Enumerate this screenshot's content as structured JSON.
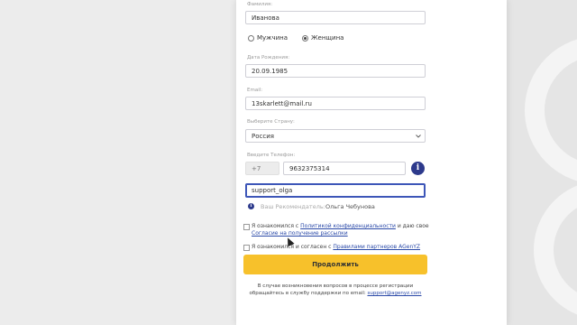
{
  "form": {
    "surname_label": "Фамилия:",
    "surname_value": "Иванова",
    "gender_male": "Мужчина",
    "gender_female": "Женщина",
    "birth_label": "Дата Рождения:",
    "birth_value": "20.09.1985",
    "email_label": "Email:",
    "email_value": "13skarlett@mail.ru",
    "country_label": "Выберите Страну:",
    "country_value": "Россия",
    "phone_label": "Введите Телефон:",
    "phone_code": "+7",
    "phone_value": "9632375314",
    "login_value": "support_olga",
    "referrer_label": "Ваш Рекомендатель:",
    "referrer_name": "Ольга Чебунова",
    "consent1_text_a": "Я ознакомился с",
    "consent1_link_a": "Политикой конфиденциальности",
    "consent1_text_b": "и даю свое",
    "consent1_link_b": "Согласие на получение рассылки",
    "consent2_text": "Я ознакомился и согласен с",
    "consent2_link": "Правилами партнеров AGenYZ",
    "submit_label": "Продолжить",
    "footer_text": "В случае возникновения вопросов в процессе регистрации обращайтесь в службу поддержки по email:",
    "footer_email": "support@agenyz.com"
  },
  "colors": {
    "accent": "#f7c12b",
    "brand_blue": "#2d3a8c",
    "link": "#2b4aa8"
  },
  "icons": {
    "info": "info-icon",
    "chevron": "chevron-down-icon"
  }
}
